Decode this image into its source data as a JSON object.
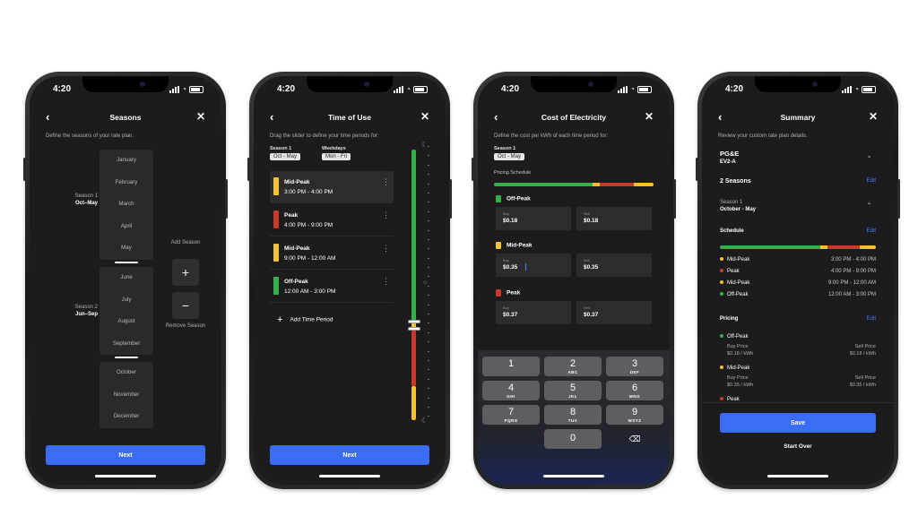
{
  "status": {
    "time": "4:20"
  },
  "colors": {
    "green": "#35b04a",
    "red": "#c9392b",
    "yellow": "#f2c232",
    "blue": "#3b6cf6",
    "link": "#4a7bff"
  },
  "seasons": {
    "title": "Seasons",
    "subtitle": "Define the seasons of your rate plan.",
    "season1": {
      "name": "Season 1",
      "range": "Oct–May"
    },
    "season2": {
      "name": "Season 2",
      "range": "Jun–Sep"
    },
    "months_a": [
      "January",
      "February",
      "March",
      "April",
      "May"
    ],
    "months_b": [
      "June",
      "July",
      "August",
      "September"
    ],
    "months_c": [
      "October",
      "November",
      "December"
    ],
    "add_label": "Add Season",
    "remove_label": "Remove Season",
    "next": "Next"
  },
  "tou": {
    "title": "Time of Use",
    "subtitle": "Drag the slider to define your time periods for:",
    "season_cap": "Season 1",
    "season_val": "Oct - May",
    "days_cap": "Weekdays",
    "days_val": "Mon - Fri",
    "periods": [
      {
        "name": "Mid-Peak",
        "range": "3:00 PM - 4:00 PM"
      },
      {
        "name": "Peak",
        "range": "4:00 PM - 9:00 PM"
      },
      {
        "name": "Mid-Peak",
        "range": "9:00 PM - 12:00 AM"
      },
      {
        "name": "Off-Peak",
        "range": "12:00 AM - 3:00 PM"
      }
    ],
    "add_period": "Add Time Period",
    "next": "Next"
  },
  "cost": {
    "title": "Cost of Electricity",
    "subtitle": "Define the cost per kWh of each time period for:",
    "season_cap": "Season 1",
    "season_val": "Oct - May",
    "schedule_label": "Pricing Schedule",
    "buy_cap": "Buy",
    "sell_cap": "Sell",
    "sections": [
      {
        "name": "Off-Peak",
        "buy": "$0.18",
        "sell": "$0.18"
      },
      {
        "name": "Mid-Peak",
        "buy": "$0.35",
        "sell": "$0.35"
      },
      {
        "name": "Peak",
        "buy": "$0.37",
        "sell": "$0.37"
      }
    ],
    "keys": [
      {
        "d": "1",
        "l": ""
      },
      {
        "d": "2",
        "l": "ABC"
      },
      {
        "d": "3",
        "l": "DEF"
      },
      {
        "d": "4",
        "l": "GHI"
      },
      {
        "d": "5",
        "l": "JKL"
      },
      {
        "d": "6",
        "l": "MNO"
      },
      {
        "d": "7",
        "l": "PQRS"
      },
      {
        "d": "8",
        "l": "TUV"
      },
      {
        "d": "9",
        "l": "WXYZ"
      },
      {
        "d": "0",
        "l": ""
      }
    ]
  },
  "summary": {
    "title": "Summary",
    "subtitle": "Review your custom rate plan details.",
    "utility": "PG&E",
    "plan": "EV2-A",
    "seasons_label": "2 Seasons",
    "edit": "Edit",
    "season_cap": "Season 1",
    "season_range": "October - May",
    "schedule_label": "Schedule",
    "schedule": [
      {
        "name": "Mid-Peak",
        "range": "3:00 PM - 4:00 PM"
      },
      {
        "name": "Peak",
        "range": "4:00 PM - 9:00 PM"
      },
      {
        "name": "Mid-Peak",
        "range": "9:00 PM - 12:00 AM"
      },
      {
        "name": "Off-Peak",
        "range": "12:00 AM - 3:00 PM"
      }
    ],
    "pricing_label": "Pricing",
    "pricing": [
      {
        "name": "Off-Peak",
        "buy_cap": "Buy Price",
        "buy": "$0.18 / kWh",
        "sell_cap": "Sell Price",
        "sell": "$0.18 / kWh"
      },
      {
        "name": "Mid-Peak",
        "buy_cap": "Buy Price",
        "buy": "$0.35 / kWh",
        "sell_cap": "Sell Price",
        "sell": "$0.35 / kWh"
      },
      {
        "name": "Peak"
      }
    ],
    "save": "Save",
    "start_over": "Start Over"
  }
}
